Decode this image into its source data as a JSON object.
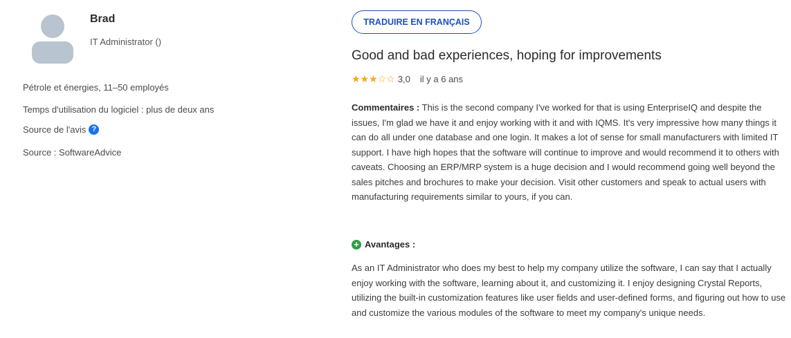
{
  "reviewer": {
    "name": "Brad",
    "role": "IT Administrator ()",
    "industry": "Pétrole et énergies, 11–50 employés",
    "usage": "Temps d'utilisation du logiciel : plus de deux ans",
    "source_label": "Source de l'avis",
    "source": "Source : SoftwareAdvice"
  },
  "review": {
    "translate_label": "TRADUIRE EN FRANÇAIS",
    "title": "Good and bad experiences, hoping for improvements",
    "rating": 3,
    "rating_max": 5,
    "rating_text": "3,0",
    "date": "il y a 6 ans",
    "comments_label": "Commentaires :",
    "comments": "This is the second company I've worked for that is using EnterpriseIQ and despite the issues, I'm glad we have it and enjoy working with it and with IQMS. It's very impressive how many things it can do all under one database and one login. It makes a lot of sense for small manufacturers with limited IT support. I have high hopes that the software will continue to improve and would recommend it to others with caveats. Choosing an ERP/MRP system is a huge decision and I would recommend going well beyond the sales pitches and brochures to make your decision. Visit other customers and speak to actual users with manufacturing requirements similar to yours, if you can.",
    "pros_label": "Avantages :",
    "pros": "As an IT Administrator who does my best to help my company utilize the software, I can say that I actually enjoy working with the software, learning about it, and customizing it. I enjoy designing Crystal Reports, utilizing the built-in customization features like user fields and user-defined forms, and figuring out how to use and customize the various modules of the software to meet my company's unique needs."
  },
  "icons": {
    "avatar": "user-avatar-icon",
    "help": "question-circle-icon",
    "star": "star-icon",
    "pros": "plus-circle-icon"
  },
  "colors": {
    "accent": "#1f4fbf",
    "star": "#f5a623",
    "pros_icon": "#2e9e47",
    "help_icon": "#1a73e8"
  }
}
